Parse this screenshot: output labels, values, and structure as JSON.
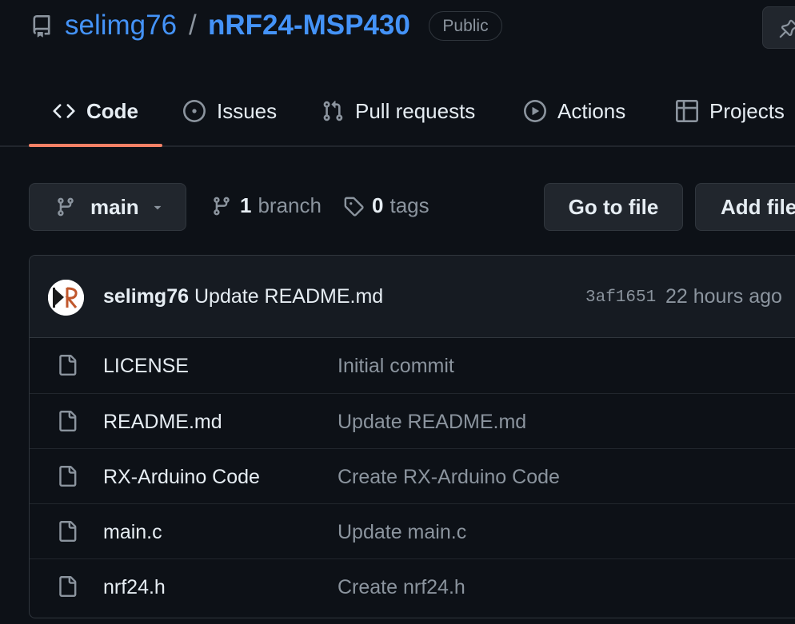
{
  "header": {
    "owner": "selimg76",
    "separator": "/",
    "repo": "nRF24-MSP430",
    "visibility": "Public"
  },
  "tabs": [
    {
      "label": "Code",
      "icon": "code-icon",
      "selected": true
    },
    {
      "label": "Issues",
      "icon": "issue-opened-icon"
    },
    {
      "label": "Pull requests",
      "icon": "git-pull-request-icon"
    },
    {
      "label": "Actions",
      "icon": "play-icon"
    },
    {
      "label": "Projects",
      "icon": "table-icon"
    }
  ],
  "branch_bar": {
    "current_branch": "main",
    "branch_count": "1",
    "branch_label": "branch",
    "tag_count": "0",
    "tag_label": "tags",
    "go_to_file": "Go to file",
    "add_file": "Add file"
  },
  "latest_commit": {
    "author": "selimg76",
    "message": "Update README.md",
    "sha": "3af1651",
    "time": "22 hours ago"
  },
  "files": [
    {
      "name": "LICENSE",
      "commit": "Initial commit"
    },
    {
      "name": "README.md",
      "commit": "Update README.md"
    },
    {
      "name": "RX-Arduino Code",
      "commit": "Create RX-Arduino Code"
    },
    {
      "name": "main.c",
      "commit": "Update main.c"
    },
    {
      "name": "nrf24.h",
      "commit": "Create nrf24.h"
    }
  ],
  "colors": {
    "background": "#0d1117",
    "link": "#4493f8",
    "muted": "#8b949e",
    "tab_underline": "#f78166"
  }
}
